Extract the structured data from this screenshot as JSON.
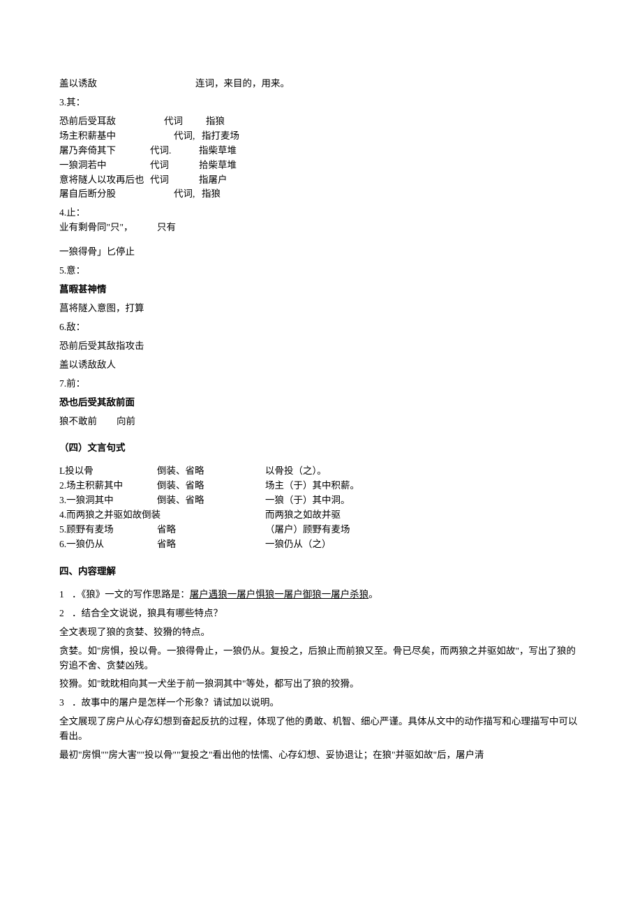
{
  "l1": {
    "a": "盖以诱敌",
    "b": "连词，来目的，用来。"
  },
  "s3": {
    "head": "3.其："
  },
  "qi": [
    {
      "a": "恐前后受耳敌",
      "b": "代词",
      "c": "指狼"
    },
    {
      "a": "场主积薪基中",
      "b": "代词,",
      "c": "指打麦场"
    },
    {
      "a": "屠乃奔倚其下",
      "b": "代词.",
      "c": "指柴草堆"
    },
    {
      "a": "一狼洞若中",
      "b": "代词",
      "c": "拾柴草堆"
    },
    {
      "a": "意将隧人以攻再后也",
      "b": "代词",
      "c": "指屠户"
    },
    {
      "a": "屠自后断分股",
      "b": "代词,",
      "c": "指狼"
    }
  ],
  "s4": {
    "head": "4.止：",
    "a": "业有剩骨同\"只\"，",
    "b": "只有",
    "c": "一狼得骨」匕停止"
  },
  "s5": {
    "head": "5.意：",
    "a": "菖暇甚神情",
    "b": "菖将隧入意图，打算"
  },
  "s6": {
    "head": "6.敌：",
    "a": "恐前后受其敌指攻击",
    "b": "盖以诱敌敌人"
  },
  "s7": {
    "head": "7.前：",
    "a": "恐也后受其敌前面",
    "b": "狼不敢前",
    "c": "向前"
  },
  "sec4": {
    "title": "（四）文言句式"
  },
  "tbl": [
    {
      "a": "L投以骨",
      "b": "倒装、省略",
      "c": "以骨投（之）。"
    },
    {
      "a": "2.场主积薪其中",
      "b": "倒装、省略",
      "c": "场主（于）其中积薪。"
    },
    {
      "a": "3.一狼洞其中",
      "b": "倒装、省略",
      "c": "一狼（于）其中洞。"
    },
    {
      "a": "4.而两狼之并驱如故倒装",
      "b": "",
      "c": "而两狼之如故并驱"
    },
    {
      "a": "5.顾野有麦场",
      "b": "省略",
      "c": "（屠户）顾野有麦场"
    },
    {
      "a": "6.一狼仍从",
      "b": "省略",
      "c": "一狼仍从（之）"
    }
  ],
  "sec5": {
    "title": "四、内容理解"
  },
  "q1": {
    "n": "1",
    "t": "．《狼》一文的写作思路是：",
    "u": "屠户遇狼一屠户惧狼一屠户御狼一屠户杀狼",
    "e": "。"
  },
  "q2": {
    "n": "2",
    "t": "．结合全文说说，狼具有哪些特点？"
  },
  "a2a": "全文表现了狼的贪婪、狡猾的特点。",
  "a2b": "贪婪。如\"房惧，投以骨。一狼得骨止，一狼仍从。复投之，后狼止而前狼又至。骨已尽矣，而两狼之并驱如故\"，写出了狼的穷追不舍、贪婪凶残。",
  "a2c": "狡猾。如\"眈眈相向其一犬坐于前一狼洞其中\"等处，都写出了狼的狡猾。",
  "q3": {
    "n": "3",
    "t": "．故事中的屠户是怎样一个形象？请试加以说明。"
  },
  "a3a": "全文展现了房户从心存幻想到奋起反抗的过程，体现了他的勇敢、机智、细心严谨。具体从文中的动作描写和心理描写中可以看出。",
  "a3b": "最初\"房惧\"\"房大害\"\"投以骨\"\"复投之\"看出他的怯懦、心存幻想、妥协退让；在狼\"并驱如故\"后，屠户清"
}
